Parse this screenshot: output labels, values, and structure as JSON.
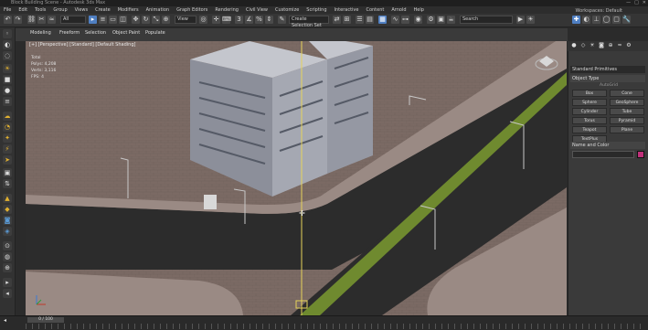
{
  "titlebar": {
    "title": "Block Building Scene - Autodesk 3ds Max",
    "buttons": [
      "—",
      "□",
      "✕"
    ]
  },
  "menubar": {
    "items": [
      "File",
      "Edit",
      "Tools",
      "Group",
      "Views",
      "Create",
      "Modifiers",
      "Animation",
      "Graph Editors",
      "Rendering",
      "Civil View",
      "Customize",
      "Scripting",
      "Interactive",
      "Content",
      "Arnold",
      "Help"
    ],
    "workspace": "Workspaces: Default"
  },
  "toolbar": {
    "selection_filter": "All",
    "reference_coord": "View",
    "selection_set": "Create Selection Set",
    "search_placeholder": "Search"
  },
  "viewport": {
    "label": "[+] [Perspective] [Standard] [Default Shading]",
    "stats_header": "Total",
    "stats": [
      {
        "label": "Polys:",
        "value": "4,208"
      },
      {
        "label": "Verts:",
        "value": "3,116"
      },
      {
        "label": "FPS:",
        "value": "4"
      }
    ],
    "tabs": [
      "Modeling",
      "Freeform",
      "Selection",
      "Object Paint",
      "Populate"
    ]
  },
  "command_panel": {
    "category": "Standard Primitives",
    "object_type_title": "Object Type",
    "autogrid": "AutoGrid",
    "buttons": [
      "Box",
      "Cone",
      "Sphere",
      "GeoSphere",
      "Cylinder",
      "Tube",
      "Torus",
      "Pyramid",
      "Teapot",
      "Plane",
      "TextPlus"
    ],
    "name_color_title": "Name and Color",
    "swatch_color": "#c0307a"
  },
  "timeline": {
    "frame_slider": "0 / 100"
  },
  "colors": {
    "ground": "#7b6a64",
    "road": "#2c2c2c",
    "median": "#6f8a2f",
    "sidewalk": "#9a8a84",
    "building": "#8c8f9a",
    "accent": "#4f7fc2"
  }
}
